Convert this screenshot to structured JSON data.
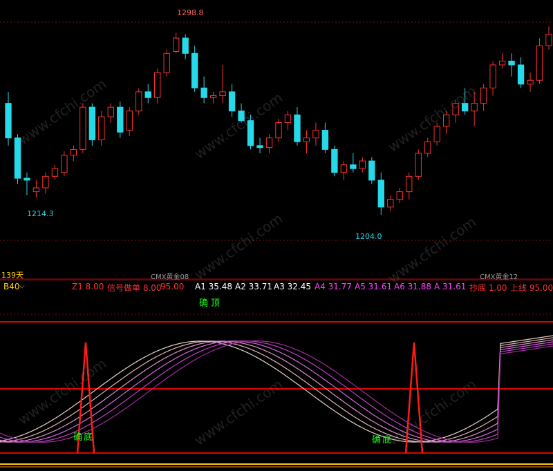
{
  "colors": {
    "background": "#000000",
    "up_candle": "#ff3030",
    "down_candle": "#26d9e9",
    "divider": "#e00000",
    "signal_text": "#19ff19"
  },
  "price_chart": {
    "high_label": "1298.8",
    "low_label_left": "1214.3",
    "low_label_right": "1204.0",
    "period_label": "139天",
    "contract_left": "CMX黄金08",
    "contract_right": "CMX黄金12"
  },
  "indicator_bar": {
    "name": "B40",
    "params": [
      {
        "label": "Z1 8.00",
        "color": "#ff3030"
      },
      {
        "label": "信号做单 8.00",
        "color": "#ff3030"
      },
      {
        "label": "95.00",
        "color": "#ff3030"
      },
      {
        "label": "A1 35.48",
        "color": "#ffffff"
      },
      {
        "label": "A2 33.71",
        "color": "#ffffff"
      },
      {
        "label": "A3 32.45",
        "color": "#ffffff"
      },
      {
        "label": "A4 31.77",
        "color": "#ff40ff"
      },
      {
        "label": "A5 31.61",
        "color": "#ff40ff"
      },
      {
        "label": "A6 31.88",
        "color": "#ff40ff"
      },
      {
        "label": "A 31.61",
        "color": "#ff40ff"
      },
      {
        "label": "抄底 1.00",
        "color": "#ff3030"
      },
      {
        "label": "上线 95.00",
        "color": "#ff3030"
      }
    ]
  },
  "signals": {
    "top": "确顶",
    "bottom": "确底"
  },
  "watermark": "www.cfchi.com",
  "chart_data": {
    "type": "candlestick",
    "title": "",
    "ylim": [
      1195,
      1305
    ],
    "candles": [
      [
        1262,
        1268,
        1240,
        1244
      ],
      [
        1244,
        1246,
        1220,
        1223
      ],
      [
        1223,
        1226,
        1214.3,
        1222
      ],
      [
        1216,
        1222,
        1213,
        1218
      ],
      [
        1218,
        1226,
        1215,
        1224
      ],
      [
        1224,
        1230,
        1222,
        1228
      ],
      [
        1226,
        1237,
        1224,
        1235
      ],
      [
        1235,
        1240,
        1232,
        1238
      ],
      [
        1238,
        1262,
        1236,
        1260
      ],
      [
        1260,
        1262,
        1240,
        1243
      ],
      [
        1243,
        1258,
        1240,
        1255
      ],
      [
        1255,
        1262,
        1252,
        1260
      ],
      [
        1260,
        1263,
        1244,
        1247
      ],
      [
        1248,
        1260,
        1245,
        1258
      ],
      [
        1258,
        1270,
        1256,
        1268
      ],
      [
        1268,
        1272,
        1262,
        1265
      ],
      [
        1265,
        1280,
        1262,
        1278
      ],
      [
        1278,
        1290,
        1276,
        1288
      ],
      [
        1289,
        1298.8,
        1288,
        1296
      ],
      [
        1296,
        1298,
        1285,
        1288
      ],
      [
        1288,
        1292,
        1268,
        1270
      ],
      [
        1270,
        1276,
        1262,
        1265
      ],
      [
        1265,
        1268,
        1262,
        1266
      ],
      [
        1266,
        1282,
        1262,
        1268
      ],
      [
        1268,
        1272,
        1255,
        1258
      ],
      [
        1258,
        1262,
        1252,
        1253
      ],
      [
        1253,
        1256,
        1238,
        1240
      ],
      [
        1240,
        1244,
        1236,
        1239
      ],
      [
        1239,
        1246,
        1236,
        1244
      ],
      [
        1244,
        1254,
        1242,
        1252
      ],
      [
        1252,
        1258,
        1248,
        1256
      ],
      [
        1256,
        1260,
        1240,
        1242
      ],
      [
        1242,
        1248,
        1236,
        1244
      ],
      [
        1244,
        1252,
        1240,
        1248
      ],
      [
        1248,
        1252,
        1236,
        1238
      ],
      [
        1238,
        1240,
        1224,
        1226
      ],
      [
        1226,
        1232,
        1222,
        1230
      ],
      [
        1230,
        1236,
        1226,
        1228
      ],
      [
        1228,
        1234,
        1226,
        1232
      ],
      [
        1232,
        1234,
        1220,
        1222
      ],
      [
        1222,
        1226,
        1204,
        1208
      ],
      [
        1208,
        1214,
        1206,
        1212
      ],
      [
        1212,
        1218,
        1210,
        1216
      ],
      [
        1216,
        1226,
        1212,
        1224
      ],
      [
        1224,
        1238,
        1222,
        1236
      ],
      [
        1236,
        1244,
        1234,
        1242
      ],
      [
        1242,
        1252,
        1240,
        1250
      ],
      [
        1250,
        1258,
        1246,
        1256
      ],
      [
        1256,
        1264,
        1252,
        1262
      ],
      [
        1262,
        1270,
        1256,
        1258
      ],
      [
        1258,
        1268,
        1250,
        1262
      ],
      [
        1262,
        1272,
        1258,
        1270
      ],
      [
        1270,
        1284,
        1266,
        1282
      ],
      [
        1282,
        1288,
        1280,
        1284
      ],
      [
        1284,
        1288,
        1276,
        1282
      ],
      [
        1282,
        1286,
        1270,
        1272
      ],
      [
        1272,
        1278,
        1268,
        1274
      ],
      [
        1274,
        1296,
        1272,
        1292
      ],
      [
        1292,
        1302,
        1290,
        1298
      ]
    ]
  }
}
